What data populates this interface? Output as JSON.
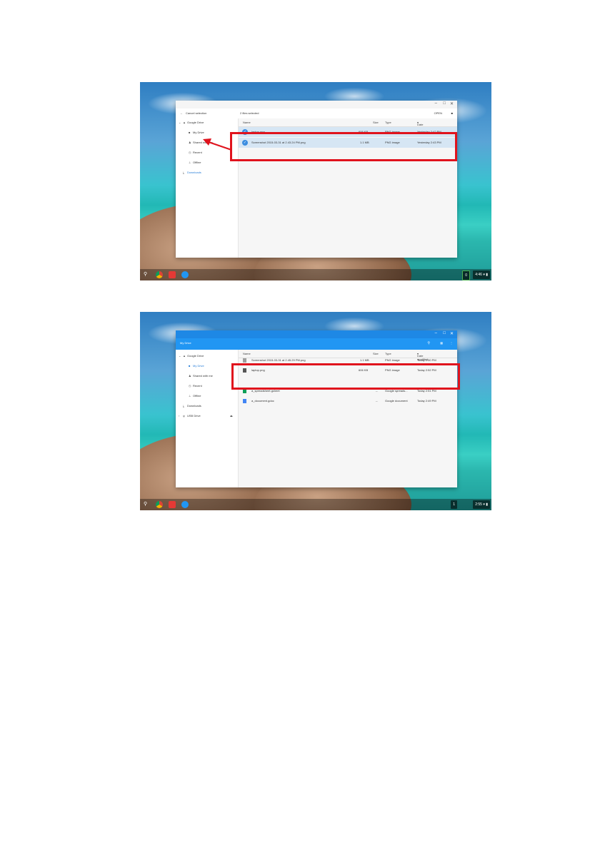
{
  "screen1": {
    "header": {
      "cancel_label": "Cancel selection",
      "selected_count": "2 files selected",
      "open_label": "OPEN"
    },
    "sidebar": {
      "root": "Google Drive",
      "items": [
        "My Drive",
        "Shared with me",
        "Recent",
        "Offline",
        "Downloads"
      ]
    },
    "columns": {
      "name": "Name",
      "size": "Size",
      "type": "Type",
      "date": "Date modified"
    },
    "rows": [
      {
        "name": "laptop.png",
        "size": "606 KB",
        "type": "PNG image",
        "date": "Yesterday 2:42 PM"
      },
      {
        "name": "Screenshot 2015-03-31 at 2.43.24 PM.png",
        "size": "1.1 MB",
        "type": "PNG image",
        "date": "Yesterday 2:43 PM"
      }
    ],
    "tray": {
      "badge": "0",
      "time": "4:46"
    }
  },
  "screen2": {
    "header": {
      "title": "My Drive"
    },
    "sidebar": {
      "root": "Google Drive",
      "items": [
        "My Drive",
        "Shared with me",
        "Recent",
        "Offline",
        "Downloads"
      ],
      "usb": "USB Drive"
    },
    "columns": {
      "name": "Name",
      "size": "Size",
      "type": "Type",
      "date": "Date modified"
    },
    "rows": [
      {
        "name": "Screenshot 2015-03-31 at 2.45.29 PM.png",
        "size": "1.1 MB",
        "type": "PNG image",
        "date": "Today 2:50 PM"
      },
      {
        "name": "laptop.png",
        "size": "606 KB",
        "type": "PNG image",
        "date": "Today 2:52 PM"
      },
      {
        "name": "a_spreadsheet.gsheet",
        "size": "--",
        "type": "Google spreads...",
        "date": "Today 2:51 PM"
      },
      {
        "name": "a_document.gdoc",
        "size": "--",
        "type": "Google document",
        "date": "Today 2:49 PM"
      }
    ],
    "tray": {
      "badge": "1",
      "time": "2:55"
    }
  },
  "colors": {
    "highlight": "#e0131d",
    "selection": "#d6e6f4",
    "accent": "#2196f3"
  }
}
